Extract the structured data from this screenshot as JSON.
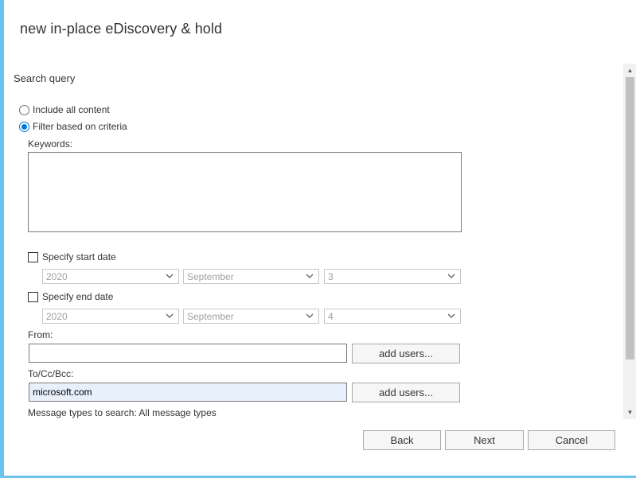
{
  "dialog": {
    "title": "new in-place eDiscovery & hold"
  },
  "search_query": {
    "heading": "Search query",
    "include_all_label": "Include all content",
    "filter_label": "Filter based on criteria",
    "selected_option": "Filter based on criteria",
    "keywords_label": "Keywords:",
    "keywords_value": ""
  },
  "start_date": {
    "label": "Specify start date",
    "checked": false,
    "year": "2020",
    "month": "September",
    "day": "3"
  },
  "end_date": {
    "label": "Specify end date",
    "checked": false,
    "year": "2020",
    "month": "September",
    "day": "4"
  },
  "from": {
    "label": "From:",
    "value": "",
    "add_users_label": "add users..."
  },
  "to": {
    "label": "To/Cc/Bcc:",
    "value": "microsoft.com",
    "add_users_label": "add users..."
  },
  "message_types": {
    "label": "Message types to search:",
    "value": "All message types"
  },
  "footer": {
    "back_label": "Back",
    "next_label": "Next",
    "cancel_label": "Cancel"
  },
  "colors": {
    "accent": "#6cc3ee",
    "radio_selected": "#0078d7",
    "filled_input_bg": "#e8f0fb"
  },
  "icons": {
    "select_arrow": "chevron-down-icon",
    "scroll_up": "scroll-up-arrow-icon",
    "scroll_down": "scroll-down-arrow-icon"
  }
}
